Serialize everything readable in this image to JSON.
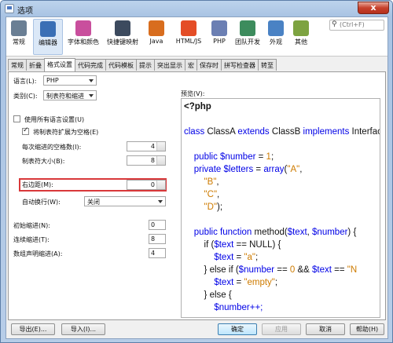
{
  "window": {
    "title": "选项",
    "close_glyph": "x"
  },
  "toolbar": {
    "categories": [
      {
        "label": "常规",
        "icon": "gear-icon",
        "color": "#6a7f94"
      },
      {
        "label": "编辑器",
        "icon": "editor-icon",
        "color": "#3a6fb5",
        "selected": true
      },
      {
        "label": "字体和颜色",
        "icon": "palette-icon",
        "color": "#c94f9d"
      },
      {
        "label": "快捷键映射",
        "icon": "keyboard-icon",
        "color": "#3c4a5e"
      },
      {
        "label": "Java",
        "icon": "java-icon",
        "color": "#d86d1e"
      },
      {
        "label": "HTML/JS",
        "icon": "html5-icon",
        "color": "#e44d26"
      },
      {
        "label": "PHP",
        "icon": "php-icon",
        "color": "#6b7fb3"
      },
      {
        "label": "团队开发",
        "icon": "team-icon",
        "color": "#3d8c5d"
      },
      {
        "label": "外观",
        "icon": "appearance-icon",
        "color": "#4a82c4"
      },
      {
        "label": "其他",
        "icon": "puzzle-icon",
        "color": "#7da341"
      }
    ],
    "search_placeholder": "(Ctrl+F)"
  },
  "tabs": [
    "常规",
    "折叠",
    "格式设置",
    "代码完成",
    "代码模板",
    "提示",
    "突出显示",
    "宏",
    "保存时",
    "拼写检查器",
    "转至"
  ],
  "active_tab": "格式设置",
  "format": {
    "language_label": "语言(L):",
    "language_value": "PHP",
    "category_label": "类别(C):",
    "category_value": "制表符和缩进",
    "use_all_lang_label": "使用所有语言设置(U)",
    "expand_tabs_label": "将制表符扩展为空格(E)",
    "indent_spaces_label": "每次缩进的空格数(I):",
    "indent_spaces_value": "4",
    "tab_size_label": "制表符大小(B):",
    "tab_size_value": "8",
    "right_margin_label": "右边距(M):",
    "right_margin_value": "0",
    "auto_wrap_label": "自动换行(W):",
    "auto_wrap_value": "关闭",
    "initial_indent_label": "初始缩进(N):",
    "initial_indent_value": "0",
    "continuation_indent_label": "连续缩进(T):",
    "continuation_indent_value": "8",
    "array_indent_label": "数组声明缩进(A):",
    "array_indent_value": "4",
    "preview_label": "预览(V):"
  },
  "code_lines": [
    [
      {
        "t": "<?php",
        "c": "plain",
        "b": true
      }
    ],
    [],
    [
      {
        "t": "class ",
        "c": "k"
      },
      {
        "t": "ClassA ",
        "c": "plain"
      },
      {
        "t": "extends ",
        "c": "k"
      },
      {
        "t": "ClassB ",
        "c": "plain"
      },
      {
        "t": "implements ",
        "c": "k"
      },
      {
        "t": "InterfaceA",
        "c": "plain"
      }
    ],
    [],
    [
      {
        "t": "    public ",
        "c": "k"
      },
      {
        "t": "$number",
        "c": "v"
      },
      {
        "t": " = ",
        "c": "plain"
      },
      {
        "t": "1",
        "c": "s"
      },
      {
        "t": ";",
        "c": "plain"
      }
    ],
    [
      {
        "t": "    private ",
        "c": "k"
      },
      {
        "t": "$letters",
        "c": "v"
      },
      {
        "t": " = ",
        "c": "plain"
      },
      {
        "t": "array",
        "c": "k"
      },
      {
        "t": "(",
        "c": "plain"
      },
      {
        "t": "\"A\"",
        "c": "s"
      },
      {
        "t": ",",
        "c": "plain"
      }
    ],
    [
      {
        "t": "        \"B\"",
        "c": "s"
      },
      {
        "t": ",",
        "c": "plain"
      }
    ],
    [
      {
        "t": "        \"C\"",
        "c": "s"
      },
      {
        "t": ",",
        "c": "plain"
      }
    ],
    [
      {
        "t": "        \"D\"",
        "c": "s"
      },
      {
        "t": ");",
        "c": "plain"
      }
    ],
    [],
    [
      {
        "t": "    public ",
        "c": "k"
      },
      {
        "t": "function ",
        "c": "k"
      },
      {
        "t": "method(",
        "c": "plain"
      },
      {
        "t": "$text",
        "c": "v"
      },
      {
        "t": ", ",
        "c": "plain"
      },
      {
        "t": "$number",
        "c": "v"
      },
      {
        "t": ") {",
        "c": "plain"
      }
    ],
    [
      {
        "t": "        if (",
        "c": "plain"
      },
      {
        "t": "$text",
        "c": "v"
      },
      {
        "t": " == NULL) {",
        "c": "plain"
      }
    ],
    [
      {
        "t": "            $text",
        "c": "v"
      },
      {
        "t": " = ",
        "c": "plain"
      },
      {
        "t": "\"a\"",
        "c": "s"
      },
      {
        "t": ";",
        "c": "plain"
      }
    ],
    [
      {
        "t": "        } else if (",
        "c": "plain"
      },
      {
        "t": "$number",
        "c": "v"
      },
      {
        "t": " == ",
        "c": "plain"
      },
      {
        "t": "0",
        "c": "s"
      },
      {
        "t": " && ",
        "c": "plain"
      },
      {
        "t": "$text",
        "c": "v"
      },
      {
        "t": " == ",
        "c": "plain"
      },
      {
        "t": "\"N",
        "c": "s"
      }
    ],
    [
      {
        "t": "            $text",
        "c": "v"
      },
      {
        "t": " = ",
        "c": "plain"
      },
      {
        "t": "\"empty\"",
        "c": "s"
      },
      {
        "t": ";",
        "c": "plain"
      }
    ],
    [
      {
        "t": "        } else {",
        "c": "plain"
      }
    ],
    [
      {
        "t": "            $number++;",
        "c": "v"
      }
    ]
  ],
  "buttons": {
    "export": "导出(E)...",
    "import": "导入(I)...",
    "ok": "确定",
    "apply": "应用",
    "cancel": "取消",
    "help": "帮助(H)"
  }
}
